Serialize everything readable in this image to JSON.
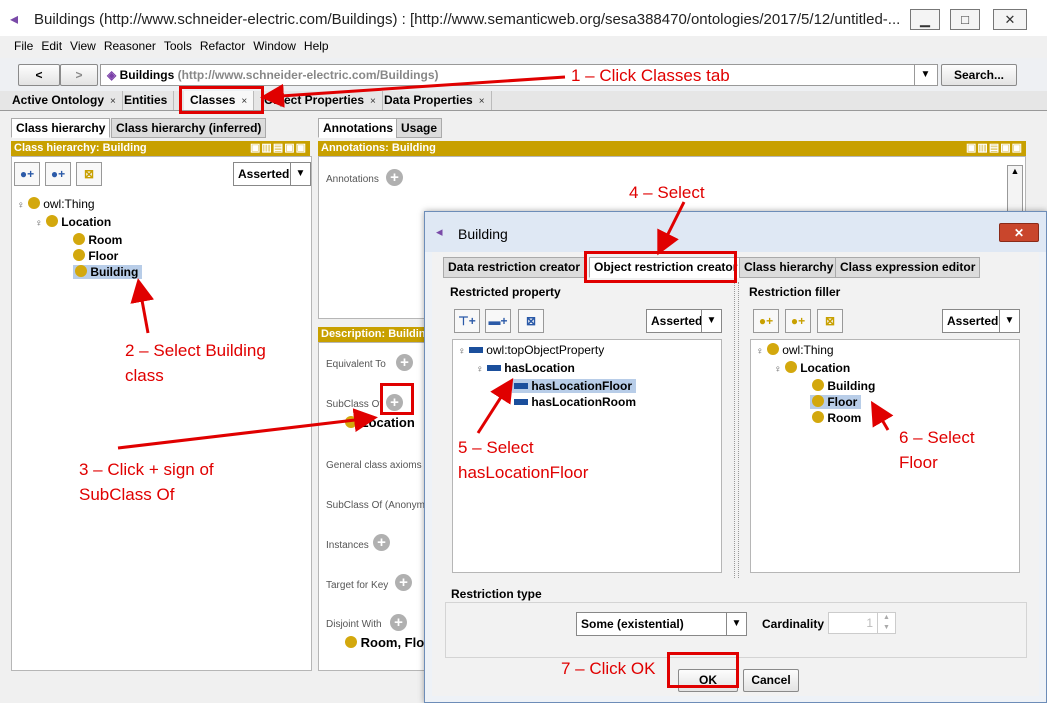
{
  "window": {
    "title": "Buildings (http://www.schneider-electric.com/Buildings)  : [http://www.semanticweb.org/sesa388470/ontologies/2017/5/12/untitled-...",
    "controls": [
      "minimize",
      "maximize",
      "close"
    ]
  },
  "menu": [
    "File",
    "Edit",
    "View",
    "Reasoner",
    "Tools",
    "Refactor",
    "Window",
    "Help"
  ],
  "nav": {
    "back": "<",
    "forward": ">",
    "ontology_name": "Buildings",
    "ontology_iri": "(http://www.schneider-electric.com/Buildings)",
    "search_label": "Search..."
  },
  "tabs": [
    {
      "label": "Active Ontology",
      "close": "×"
    },
    {
      "label": "Entities",
      "close": ""
    },
    {
      "label": "Classes",
      "close": "×"
    },
    {
      "label": "Object Properties",
      "close": "×"
    },
    {
      "label": "Data Properties",
      "close": "×"
    }
  ],
  "left": {
    "tabs": [
      "Class hierarchy",
      "Class hierarchy (inferred)"
    ],
    "header": "Class hierarchy: Building",
    "mode": "Asserted",
    "tree": {
      "root": "owl:Thing",
      "parent": "Location",
      "children": [
        "Room",
        "Floor",
        "Building"
      ]
    }
  },
  "right": {
    "tabs": [
      "Annotations",
      "Usage"
    ],
    "annotations_header": "Annotations: Building",
    "annotations_label": "Annotations",
    "description_header": "Description: Buildin",
    "sections": {
      "equivalent_to": "Equivalent To",
      "subclass_of": "SubClass Of",
      "subclass_value": "Location",
      "general_axioms": "General class axioms",
      "subclass_anon": "SubClass Of (Anonym",
      "instances": "Instances",
      "target_for_key": "Target for Key",
      "disjoint_with": "Disjoint With",
      "disjoint_value": "Room, Flo"
    }
  },
  "dialog": {
    "title": "Building",
    "close": "✕",
    "tabs": [
      "Data restriction creator",
      "Object restriction creator",
      "Class hierarchy",
      "Class expression editor"
    ],
    "restricted_property_label": "Restricted property",
    "restriction_filler_label": "Restriction filler",
    "mode": "Asserted",
    "property_tree": {
      "root": "owl:topObjectProperty",
      "parent": "hasLocation",
      "children": [
        "hasLocationFloor",
        "hasLocationRoom"
      ]
    },
    "filler_tree": {
      "root": "owl:Thing",
      "parent": "Location",
      "children": [
        "Building",
        "Floor",
        "Room"
      ]
    },
    "restriction_type_label": "Restriction type",
    "restriction_type": "Some (existential)",
    "cardinality_label": "Cardinality",
    "cardinality_value": "1",
    "ok": "OK",
    "cancel": "Cancel"
  },
  "annotations": {
    "step1": "1 – Click Classes tab",
    "step2a": "2 – Select Building",
    "step2b": "class",
    "step3a": "3 – Click + sign of",
    "step3b": "SubClass Of",
    "step4": "4 – Select",
    "step5a": "5 – Select",
    "step5b": "hasLocationFloor",
    "step6a": "6 – Select",
    "step6b": "Floor",
    "step7": "7 – Click OK"
  },
  "colors": {
    "annotation_red": "#e00000",
    "header_gold": "#c8a000",
    "selection": "#b8cde8",
    "property_blue": "#1b4f9c",
    "class_ball": "#d3a80d"
  }
}
